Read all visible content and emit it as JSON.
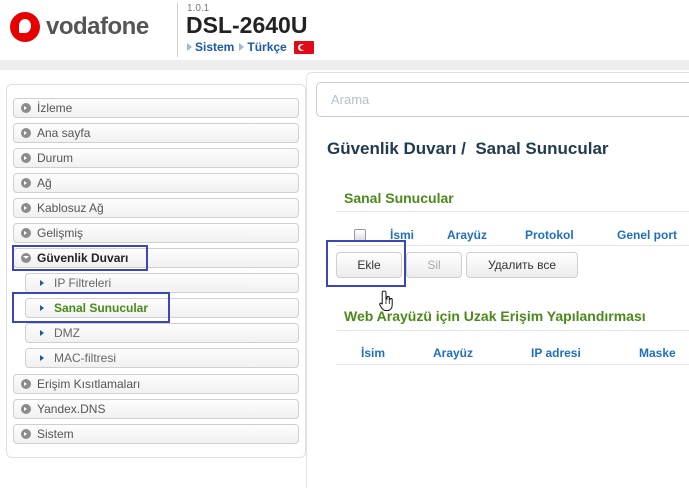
{
  "header": {
    "brand": "vodafone",
    "version": "1.0.1",
    "model": "DSL-2640U",
    "crumbs": [
      "Sistem",
      "Türkçe"
    ]
  },
  "search": {
    "placeholder": "Arama"
  },
  "sidebar": {
    "items": [
      {
        "label": "İzleme"
      },
      {
        "label": "Ana sayfa"
      },
      {
        "label": "Durum"
      },
      {
        "label": "Ağ"
      },
      {
        "label": "Kablosuz Ağ"
      },
      {
        "label": "Gelişmiş"
      },
      {
        "label": "Güvenlik Duvarı"
      },
      {
        "label": "Erişim Kısıtlamaları"
      },
      {
        "label": "Yandex.DNS"
      },
      {
        "label": "Sistem"
      }
    ],
    "subitems": [
      {
        "label": "IP Filtreleri"
      },
      {
        "label": "Sanal Sunucular"
      },
      {
        "label": "DMZ"
      },
      {
        "label": "MAC-filtresi"
      }
    ]
  },
  "main": {
    "page_title": "Güvenlik Duvarı /  Sanal Sunucular",
    "virtual_servers": {
      "title": "Sanal Sunucular",
      "columns": [
        "İsmi",
        "Arayüz",
        "Protokol",
        "Genel port"
      ],
      "buttons": {
        "add": "Ekle",
        "delete": "Sil",
        "delete_all": "Удалить все"
      }
    },
    "remote_access": {
      "title": "Web Arayüzü için Uzak Erişim Yapılandırması",
      "columns": [
        "İsim",
        "Arayüz",
        "IP adresi",
        "Maske"
      ]
    }
  },
  "colors": {
    "brand_red": "#e60000",
    "link_blue": "#1f6fbf",
    "section_green": "#4a8a1a",
    "highlight_box": "#3b47b8"
  }
}
